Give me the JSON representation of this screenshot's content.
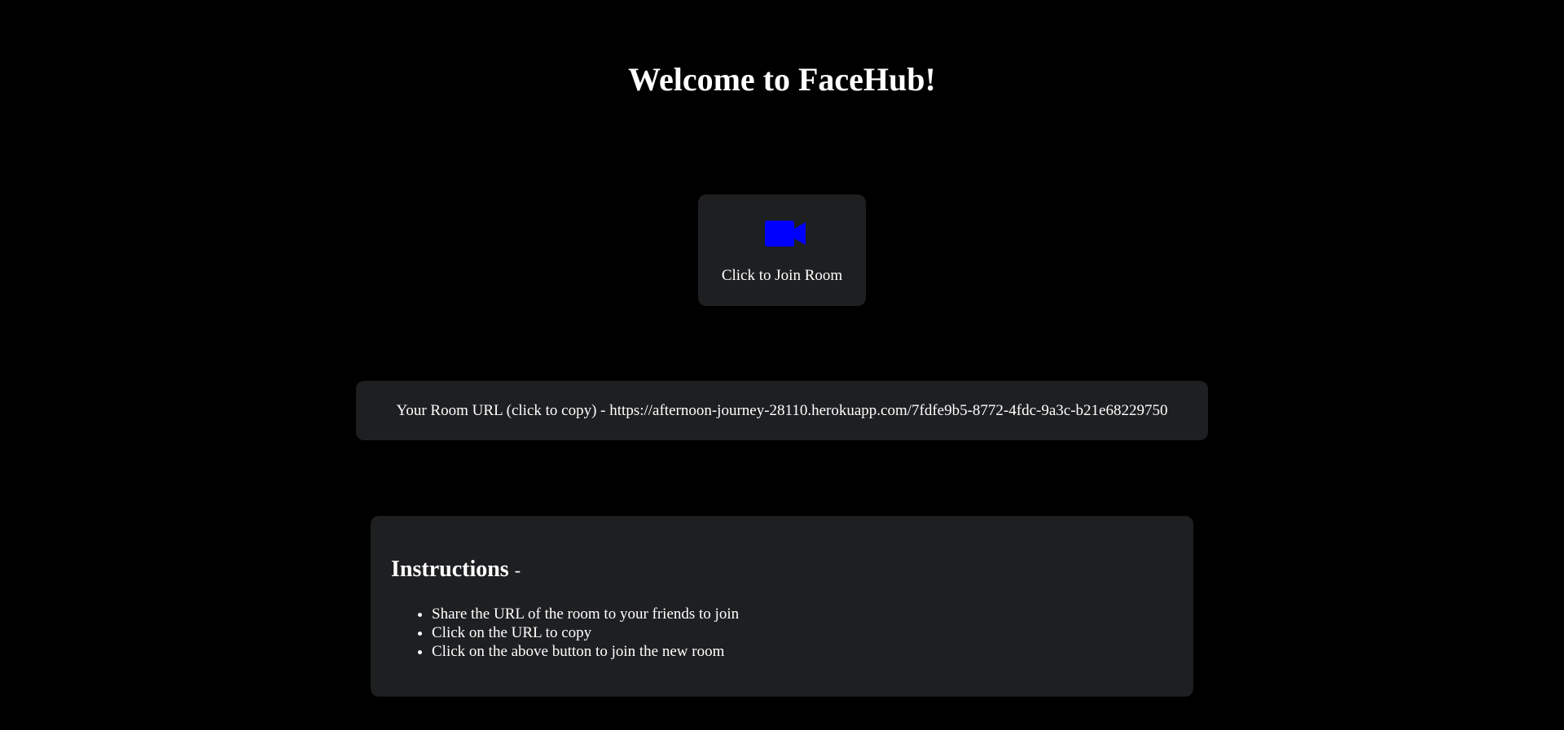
{
  "page": {
    "title": "Welcome to FaceHub!"
  },
  "join": {
    "icon": "video-camera-icon",
    "icon_color": "#0000ff",
    "label": "Click to Join Room"
  },
  "room_url": {
    "text": "Your Room URL (click to copy) - https://afternoon-journey-28110.herokuapp.com/7fdfe9b5-8772-4fdc-9a3c-b21e68229750"
  },
  "instructions": {
    "heading": "Instructions",
    "heading_suffix": "-",
    "items": [
      "Share the URL of the room to your friends to join",
      "Click on the URL to copy",
      "Click on the above button to join the new room"
    ]
  },
  "colors": {
    "background": "#000000",
    "card": "#1e1f21",
    "text": "#ffffff",
    "accent": "#0000ff"
  }
}
